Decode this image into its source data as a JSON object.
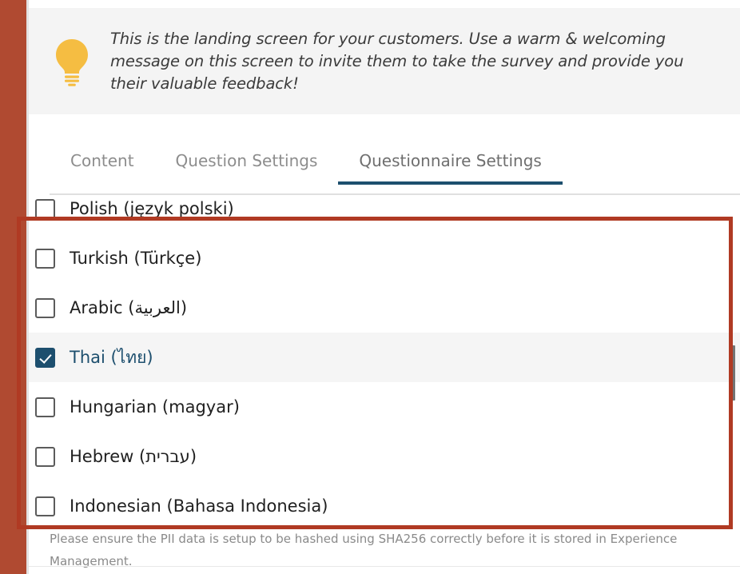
{
  "tip_banner": {
    "icon": "lightbulb-icon",
    "icon_color": "#f5bd42",
    "text": "This is the landing screen for your customers. Use a warm & welcoming message on this screen to invite them to take the survey and provide you their valuable feedback!"
  },
  "tabs": {
    "active_index": 2,
    "items": [
      {
        "label": "Content",
        "active": false
      },
      {
        "label": "Question Settings",
        "active": false
      },
      {
        "label": "Questionnaire Settings",
        "active": true
      }
    ],
    "active_underline_color": "#1d4f6e"
  },
  "language_list": {
    "items": [
      {
        "label": "Polish (język polski)",
        "checked": false,
        "selected": false
      },
      {
        "label": "Turkish (Türkçe)",
        "checked": false,
        "selected": false
      },
      {
        "label": "Arabic (العربية)",
        "checked": false,
        "selected": false
      },
      {
        "label": "Thai (ไทย)",
        "checked": true,
        "selected": true
      },
      {
        "label": "Hungarian (magyar)",
        "checked": false,
        "selected": false
      },
      {
        "label": "Hebrew (עברית)",
        "checked": false,
        "selected": false
      },
      {
        "label": "Indonesian (Bahasa Indonesia)",
        "checked": false,
        "selected": false
      }
    ],
    "selected_checkbox_color": "#1d4f6e",
    "selected_label_color": "#1d4f6e",
    "selected_row_background": "#f5f5f5"
  },
  "scrollbar": {
    "orientation": "vertical",
    "thumb_color": "#737373"
  },
  "bottom_note": {
    "text": "Please ensure the PII data is setup to be hashed using SHA256 correctly before it is stored in Experience Management."
  },
  "annotation": {
    "shape": "rectangle",
    "color": "#b03a23"
  },
  "chrome": {
    "left_rail_color": "#b04a31"
  }
}
